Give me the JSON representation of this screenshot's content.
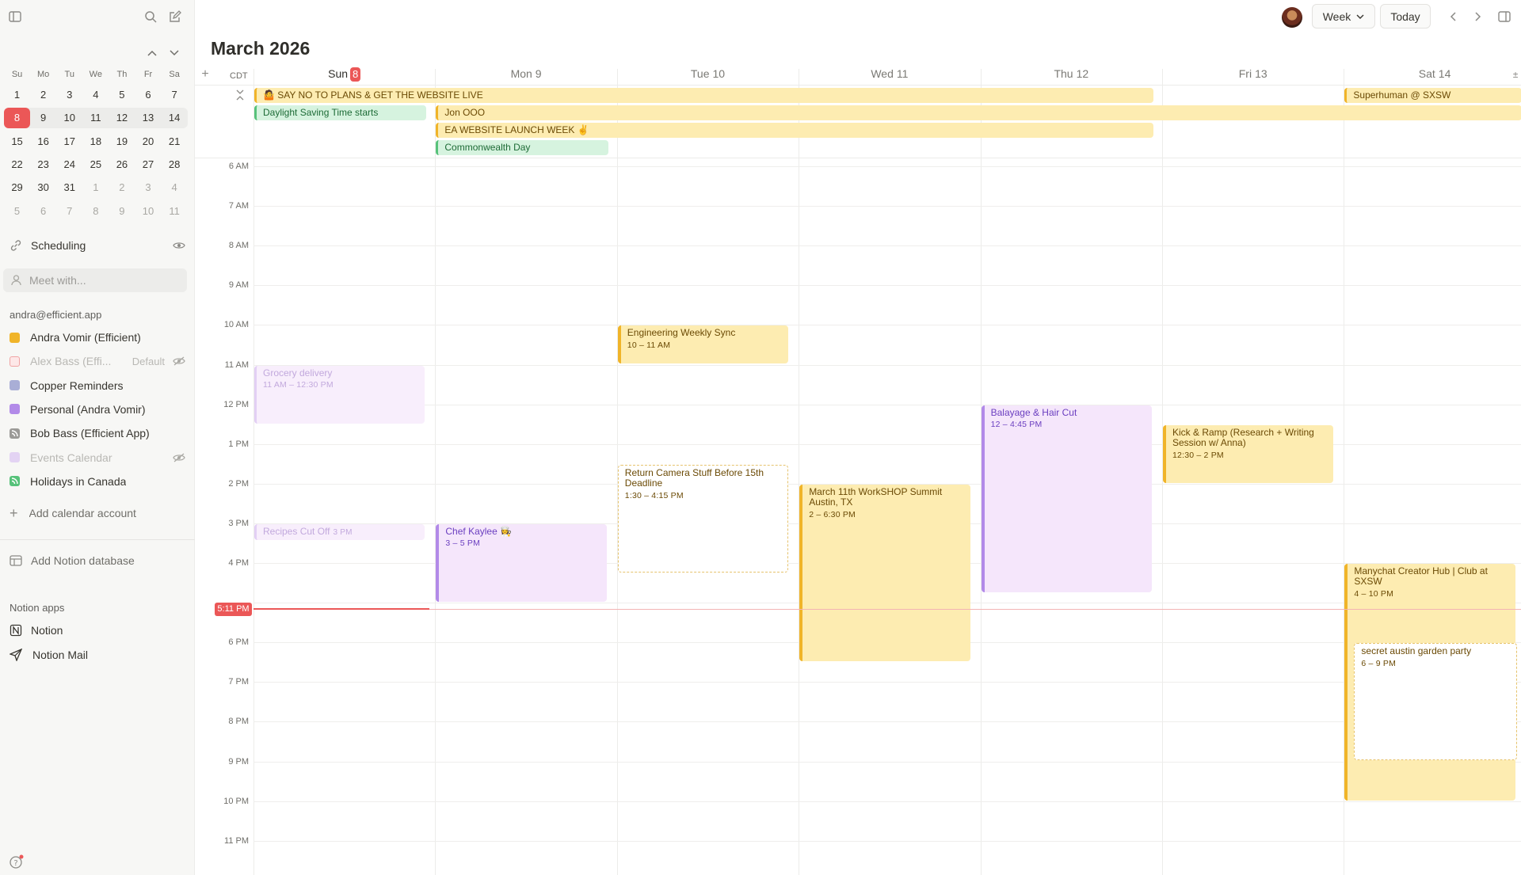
{
  "sidebar": {
    "mini_calendar": {
      "weekdays": [
        "Su",
        "Mo",
        "Tu",
        "We",
        "Th",
        "Fr",
        "Sa"
      ],
      "weeks": [
        [
          "1",
          "2",
          "3",
          "4",
          "5",
          "6",
          "7"
        ],
        [
          "8",
          "9",
          "10",
          "11",
          "12",
          "13",
          "14"
        ],
        [
          "15",
          "16",
          "17",
          "18",
          "19",
          "20",
          "21"
        ],
        [
          "22",
          "23",
          "24",
          "25",
          "26",
          "27",
          "28"
        ],
        [
          "29",
          "30",
          "31",
          "1",
          "2",
          "3",
          "4"
        ],
        [
          "5",
          "6",
          "7",
          "8",
          "9",
          "10",
          "11"
        ]
      ]
    },
    "scheduling_label": "Scheduling",
    "meet_placeholder": "Meet with...",
    "account_email": "andra@efficient.app",
    "calendars": [
      {
        "label": "Andra Vomir (Efficient)",
        "color": "#f0b429"
      },
      {
        "label": "Alex Bass (Effi...",
        "badge": "Default",
        "color": "#f6c6c6"
      },
      {
        "label": "Copper Reminders",
        "color": "#a9aed6"
      },
      {
        "label": "Personal (Andra Vomir)",
        "color": "#b28ae8"
      },
      {
        "label": "Bob Bass (Efficient App)",
        "color": "#9b9a97"
      },
      {
        "label": "Events Calendar",
        "color": "#e3d3f3"
      },
      {
        "label": "Holidays in Canada",
        "color": "#57c27a"
      }
    ],
    "add_calendar_account": "Add calendar account",
    "add_notion_database": "Add Notion database",
    "notion_apps_heading": "Notion apps",
    "notion_apps": [
      {
        "label": "Notion",
        "icon": "notion-icon"
      },
      {
        "label": "Notion Mail",
        "icon": "send-icon"
      }
    ]
  },
  "topbar": {
    "view_label": "Week",
    "today_label": "Today"
  },
  "calendar": {
    "month_title": "March 2026",
    "timezone": "CDT",
    "days": [
      {
        "name": "Sun",
        "num": "8",
        "is_today": true
      },
      {
        "name": "Mon",
        "num": "9"
      },
      {
        "name": "Tue",
        "num": "10"
      },
      {
        "name": "Wed",
        "num": "11"
      },
      {
        "name": "Thu",
        "num": "12"
      },
      {
        "name": "Fri",
        "num": "13"
      },
      {
        "name": "Sat",
        "num": "14"
      }
    ],
    "hours": [
      "6 AM",
      "7 AM",
      "8 AM",
      "9 AM",
      "10 AM",
      "11 AM",
      "12 PM",
      "1 PM",
      "2 PM",
      "3 PM",
      "4 PM",
      "5 PM",
      "6 PM",
      "7 PM",
      "8 PM",
      "9 PM",
      "10 PM",
      "11 PM"
    ],
    "now_label": "5:11 PM",
    "all_day_events": [
      {
        "title": "🤷 SAY NO TO PLANS & GET THE WEBSITE LIVE",
        "color": "yellow"
      },
      {
        "title": "Superhuman @ SXSW",
        "color": "yellow"
      },
      {
        "title": "Daylight Saving Time starts",
        "color": "green"
      },
      {
        "title": "Jon OOO",
        "color": "yellow"
      },
      {
        "title": "EA WEBSITE LAUNCH WEEK ✌️",
        "color": "yellow"
      },
      {
        "title": "Commonwealth Day",
        "color": "green"
      }
    ],
    "events": [
      {
        "title": "Engineering Weekly Sync",
        "time": "10 – 11 AM",
        "style": "yellow"
      },
      {
        "title": "Grocery delivery",
        "time": "11 AM – 12:30 PM",
        "style": "purple-faded"
      },
      {
        "title": "Balayage & Hair Cut",
        "time": "12 – 4:45 PM",
        "style": "purple"
      },
      {
        "title": "Kick & Ramp (Research + Writing Session w/ Anna)",
        "time": "12:30 – 2 PM",
        "style": "yellow"
      },
      {
        "title": "Return Camera Stuff Before 15th Deadline",
        "time": "1:30 – 4:15 PM",
        "style": "dashed"
      },
      {
        "title": "March 11th WorkSHOP Summit Austin, TX",
        "time": "2 – 6:30 PM",
        "style": "yellow"
      },
      {
        "title": "Recipes Cut Off",
        "time": "3 PM",
        "style": "purple-faded"
      },
      {
        "title": "Chef Kaylee 👩‍🍳",
        "time": "3 – 5 PM",
        "style": "purple"
      },
      {
        "title": "Manychat Creator Hub | Club at SXSW",
        "time": "4 – 10 PM",
        "style": "yellow"
      },
      {
        "title": "secret austin garden party",
        "time": "6 – 9 PM",
        "style": "dashed"
      }
    ]
  }
}
